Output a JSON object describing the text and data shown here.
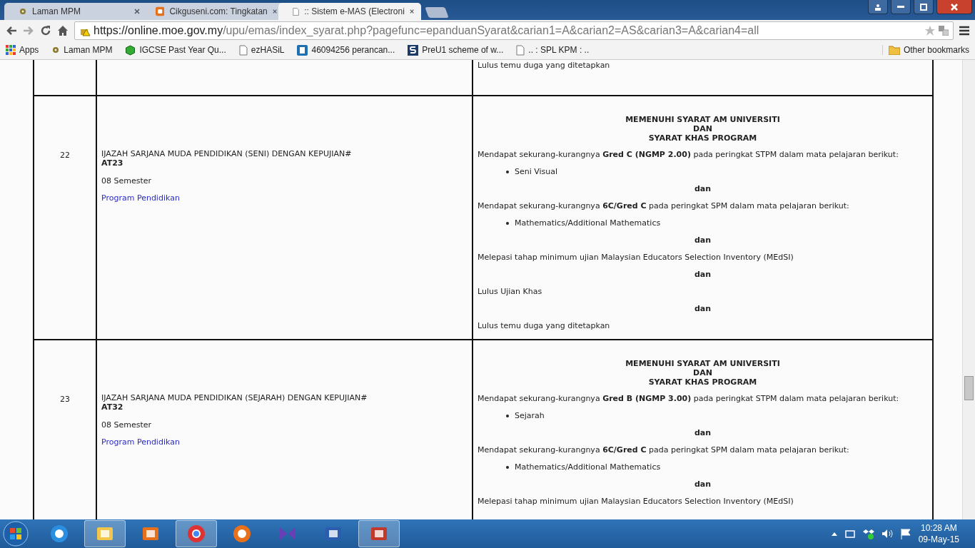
{
  "tabs": [
    {
      "title": "Laman MPM",
      "selected": false
    },
    {
      "title": "Cikguseni.com: Tingkatan",
      "selected": false
    },
    {
      "title": ":: Sistem e-MAS (Electroni",
      "selected": true
    }
  ],
  "address": {
    "url_host": "https://online.moe.gov.my",
    "url_path": "/upu/emas/index_syarat.php?pagefunc=epanduanSyarat&carian1=A&carian2=AS&carian3=A&carian4=all"
  },
  "bookmarks": [
    {
      "label": "Apps"
    },
    {
      "label": "Laman MPM"
    },
    {
      "label": "IGCSE Past Year Qu..."
    },
    {
      "label": "ezHASiL"
    },
    {
      "label": "46094256 perancan..."
    },
    {
      "label": "PreU1 scheme of w..."
    },
    {
      "label": ".. : SPL KPM : .."
    }
  ],
  "other_bookmarks": "Other bookmarks",
  "rows": [
    {
      "requirements": [
        {
          "kind": "para",
          "text": "Lulus temu duga yang ditetapkan"
        }
      ]
    },
    {
      "number": "22",
      "title": "IJAZAH SARJANA MUDA PENDIDIKAN (SENI) DENGAN KEPUJIAN#",
      "code": "AT23",
      "duration": "08 Semester",
      "link": "Program Pendidikan",
      "requirements": [
        {
          "kind": "heading",
          "lines": [
            "MEMENUHI SYARAT AM UNIVERSITI",
            "DAN",
            "SYARAT KHAS PROGRAM"
          ]
        },
        {
          "kind": "para",
          "text": "Mendapat sekurang-kurangnya **Gred C (NGMP 2.00)** pada peringkat STPM dalam mata pelajaran berikut:"
        },
        {
          "kind": "bullet",
          "text": "Seni Visual"
        },
        {
          "kind": "dan",
          "text": "dan"
        },
        {
          "kind": "para",
          "text": "Mendapat sekurang-kurangnya **6C/Gred C** pada peringkat SPM dalam mata pelajaran berikut:"
        },
        {
          "kind": "bullet",
          "text": "Mathematics/Additional Mathematics"
        },
        {
          "kind": "dan",
          "text": "dan"
        },
        {
          "kind": "para",
          "text": "Melepasi tahap minimum ujian Malaysian Educators Selection Inventory (MEdSI)"
        },
        {
          "kind": "dan",
          "text": "dan"
        },
        {
          "kind": "para",
          "text": "Lulus Ujian Khas"
        },
        {
          "kind": "dan",
          "text": "dan"
        },
        {
          "kind": "para",
          "text": "Lulus temu duga yang ditetapkan"
        }
      ]
    },
    {
      "number": "23",
      "title": "IJAZAH SARJANA MUDA PENDIDIKAN (SEJARAH) DENGAN KEPUJIAN#",
      "code": "AT32",
      "duration": "08 Semester",
      "link": "Program Pendidikan",
      "requirements": [
        {
          "kind": "heading",
          "lines": [
            "MEMENUHI SYARAT AM UNIVERSITI",
            "DAN",
            "SYARAT KHAS PROGRAM"
          ]
        },
        {
          "kind": "para",
          "text": "Mendapat sekurang-kurangnya **Gred B (NGMP 3.00)** pada peringkat STPM dalam mata pelajaran berikut:"
        },
        {
          "kind": "bullet",
          "text": "Sejarah"
        },
        {
          "kind": "dan",
          "text": "dan"
        },
        {
          "kind": "para",
          "text": "Mendapat sekurang-kurangnya **6C/Gred C** pada peringkat SPM dalam mata pelajaran berikut:"
        },
        {
          "kind": "bullet",
          "text": "Mathematics/Additional Mathematics"
        },
        {
          "kind": "dan",
          "text": "dan"
        },
        {
          "kind": "para",
          "text": "Melepasi tahap minimum ujian Malaysian Educators Selection Inventory (MEdSI)"
        }
      ]
    }
  ],
  "taskbar": {
    "apps": [
      {
        "selected": false
      },
      {
        "selected": true
      },
      {
        "selected": false
      },
      {
        "selected": true
      },
      {
        "selected": false
      },
      {
        "selected": false
      },
      {
        "selected": false
      },
      {
        "selected": true
      }
    ],
    "time": "10:28 AM",
    "date": "09-May-15"
  }
}
